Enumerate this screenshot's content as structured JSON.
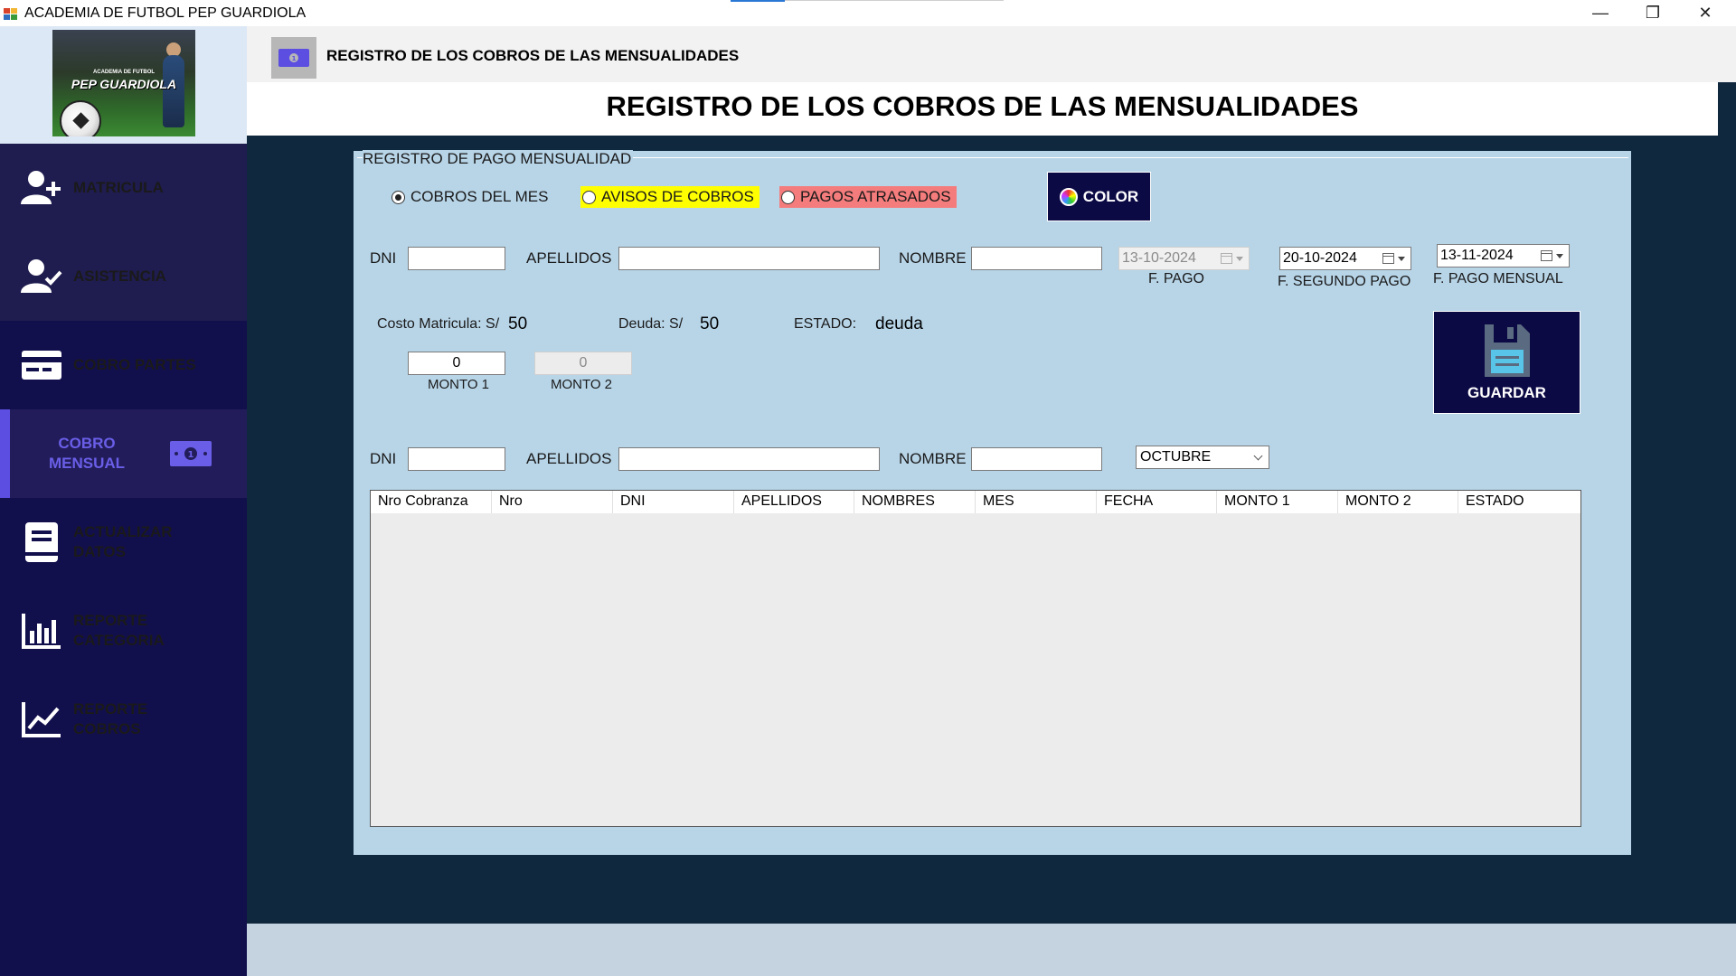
{
  "window": {
    "title": "ACADEMIA DE FUTBOL PEP GUARDIOLA",
    "minimize_glyph": "—",
    "maximize_glyph": "❐",
    "close_glyph": "✕"
  },
  "logo": {
    "line1": "ACADEMIA DE FUTBOL",
    "line2": "PEP GUARDIOLA"
  },
  "sidebar": {
    "items": [
      {
        "label": "MATRICULA",
        "icon": "user-plus-icon"
      },
      {
        "label": "ASISTENCIA",
        "icon": "user-check-icon"
      },
      {
        "label": "COBRO PARTES",
        "icon": "credit-card-icon"
      },
      {
        "label": "COBRO MENSUAL",
        "icon": "money-bill-icon",
        "active": true
      },
      {
        "label": "ACTUALIZAR DATOS",
        "icon": "book-icon"
      },
      {
        "label": "REPORTE CATEGORIA",
        "icon": "bar-chart-icon"
      },
      {
        "label": "REPORTE COBROS",
        "icon": "line-chart-icon"
      }
    ]
  },
  "header": {
    "title": "REGISTRO DE LOS COBROS DE LAS MENSUALIDADES",
    "icon": "money-bill-icon"
  },
  "main": {
    "title": "REGISTRO DE LOS COBROS DE LAS MENSUALIDADES",
    "group_label": "REGISTRO DE PAGO MENSUALIDAD",
    "radios": {
      "cobros_mes": "COBROS DEL MES",
      "avisos": "AVISOS DE COBROS",
      "atrasados": "PAGOS ATRASADOS"
    },
    "color_button": "COLOR",
    "form": {
      "dni_label": "DNI",
      "apellidos_label": "APELLIDOS",
      "nombre_label": "NOMBRE",
      "dni_value": "",
      "apellidos_value": "",
      "nombre_value": "",
      "f_pago": "13-10-2024",
      "f_pago_label": "F. PAGO",
      "f_segundo_pago": "20-10-2024",
      "f_segundo_pago_label": "F. SEGUNDO PAGO",
      "f_pago_mensual": "13-11-2024",
      "f_pago_mensual_label": "F. PAGO MENSUAL",
      "costo_label": "Costo Matricula: S/",
      "costo_value": "50",
      "deuda_label": "Deuda: S/",
      "deuda_value": "50",
      "estado_label": "ESTADO:",
      "estado_value": "deuda",
      "monto1_value": "0",
      "monto1_label": "MONTO 1",
      "monto2_value": "0",
      "monto2_label": "MONTO 2"
    },
    "save_button": "GUARDAR",
    "search": {
      "dni_label": "DNI",
      "apellidos_label": "APELLIDOS",
      "nombre_label": "NOMBRE",
      "month": "OCTUBRE"
    },
    "table": {
      "columns": [
        "Nro Cobranza",
        "Nro",
        "DNI",
        "APELLIDOS",
        "NOMBRES",
        "MES",
        "FECHA",
        "MONTO 1",
        "MONTO 2",
        "ESTADO"
      ],
      "rows": []
    }
  },
  "colors": {
    "sidebar_bg": "#120f4d",
    "content_bg": "#10283e",
    "panel_bg": "#b8d5e8",
    "avisos_highlight": "#ffff00",
    "atrasados_highlight": "#f47c7c",
    "button_bg": "#0c0a45",
    "active_accent": "#5b4ee0"
  }
}
